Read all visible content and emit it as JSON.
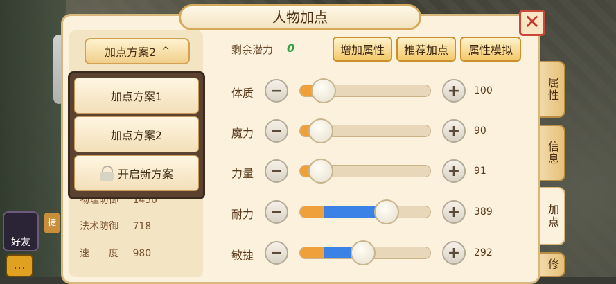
{
  "window": {
    "title": "人物加点",
    "close_glyph": "✕"
  },
  "plan": {
    "current_label": "加点方案2",
    "caret": "^",
    "options": [
      "加点方案1",
      "加点方案2"
    ],
    "unlock_label": "开启新方案"
  },
  "stats_partial": [
    {
      "label": "物理防御",
      "value": "1430"
    },
    {
      "label": "法术防御",
      "value": "718"
    },
    {
      "label": "速　　度",
      "value": "980"
    }
  ],
  "potential": {
    "label": "剩余潜力",
    "value": "0"
  },
  "top_buttons": [
    "增加属性",
    "推荐加点",
    "属性模拟"
  ],
  "attributes": [
    {
      "label": "体质",
      "value": "100",
      "base_fraction": 0.18,
      "added_fraction": 0.0
    },
    {
      "label": "魔力",
      "value": "90",
      "base_fraction": 0.16,
      "added_fraction": 0.0
    },
    {
      "label": "力量",
      "value": "91",
      "base_fraction": 0.16,
      "added_fraction": 0.0
    },
    {
      "label": "耐力",
      "value": "389",
      "base_fraction": 0.21,
      "added_fraction": 0.45
    },
    {
      "label": "敏捷",
      "value": "292",
      "base_fraction": 0.21,
      "added_fraction": 0.27
    }
  ],
  "side_tabs": [
    "属性",
    "信息",
    "加点",
    "修"
  ],
  "game_ui": {
    "friend_label": "好友",
    "quick_label": "捷"
  },
  "colors": {
    "accent_orange": "#f0a03a",
    "accent_blue": "#3b82e6",
    "potential_green": "#2ea043",
    "close_red": "#c8362a"
  }
}
